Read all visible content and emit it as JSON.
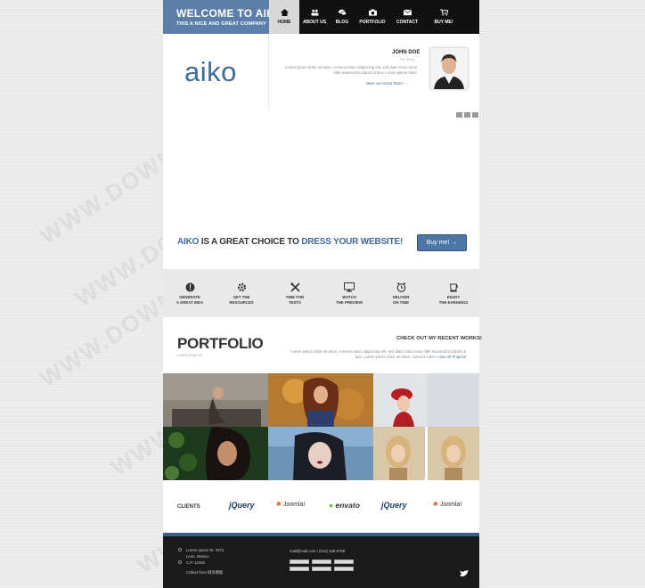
{
  "header": {
    "title": "WELCOME TO AIKO",
    "subtitle": "THIS A NICE AND GREAT COMPANY",
    "nav": [
      {
        "label": "HOME",
        "icon": "home-icon",
        "active": true
      },
      {
        "label": "ABOUT US",
        "icon": "people-icon"
      },
      {
        "label": "BLOG",
        "icon": "chat-icon"
      },
      {
        "label": "PORTFOLIO",
        "icon": "camera-icon"
      },
      {
        "label": "CONTACT",
        "icon": "envelope-icon"
      },
      {
        "label": "BUY ME!",
        "icon": "cart-icon"
      }
    ]
  },
  "hero": {
    "logo": "aiko",
    "person_name": "JOHN DOE",
    "person_role": "The Boss",
    "quote": "Lorem ipsum dolor sit amet, consect etuer adipiscing elit, sed diam nonu mmy nibh euismod tincidunt ut laor. Lorem ipsum dolor",
    "link": "Meet our Great Team! →"
  },
  "tagline": {
    "part1": "AIKO",
    "part2": " IS A GREAT CHOICE TO ",
    "part3": "DRESS YOUR WEBSITE!",
    "button": "Buy me! →"
  },
  "features": [
    {
      "line1": "GENERATE",
      "line2": "A GREAT IDEA",
      "icon": "idea-icon"
    },
    {
      "line1": "GET THE",
      "line2": "RESOURCES",
      "icon": "gear-icon"
    },
    {
      "line1": "TIME FOR",
      "line2": "TESTS",
      "icon": "tools-icon"
    },
    {
      "line1": "WATCH",
      "line2": "THE PREVIEW",
      "icon": "monitor-icon"
    },
    {
      "line1": "DELIVER",
      "line2": "ON TIME",
      "icon": "clock-icon"
    },
    {
      "line1": "ENJOY",
      "line2": "THE EARNINGS",
      "icon": "cup-icon"
    }
  ],
  "portfolio": {
    "title": "PORTFOLIO",
    "subtitle": "Latest projects",
    "right_title": "CHECK OUT MY RECENT WORKS!",
    "desc": "Lorem ipsum dolor sit amet, consect etuer adipiscing elit, sed diam nonu mmy nibh euismod tincidunt ut laor. Lorem ipsum dolor sit amet, consect etuer",
    "link": "» See All Projects"
  },
  "clients": {
    "label": "CLIENTS",
    "logos": [
      "jQuery",
      "Joomla!",
      "envato",
      "jQuery",
      "Joomla!"
    ]
  },
  "footer": {
    "address": [
      "Lorem Ipsum St. #271",
      "Leon, Mexico",
      "C.P. 12345"
    ],
    "credit": "Collect from 网页模板",
    "contact": "mail@mail.com / (012) 345 6789"
  },
  "watermark": "WWW.DOWNDEMO.COM",
  "colors": {
    "brand": "#5b7fa8",
    "accent": "#3f6a96",
    "header_bg": "#111111",
    "footer_bg": "#1a1a1a"
  }
}
